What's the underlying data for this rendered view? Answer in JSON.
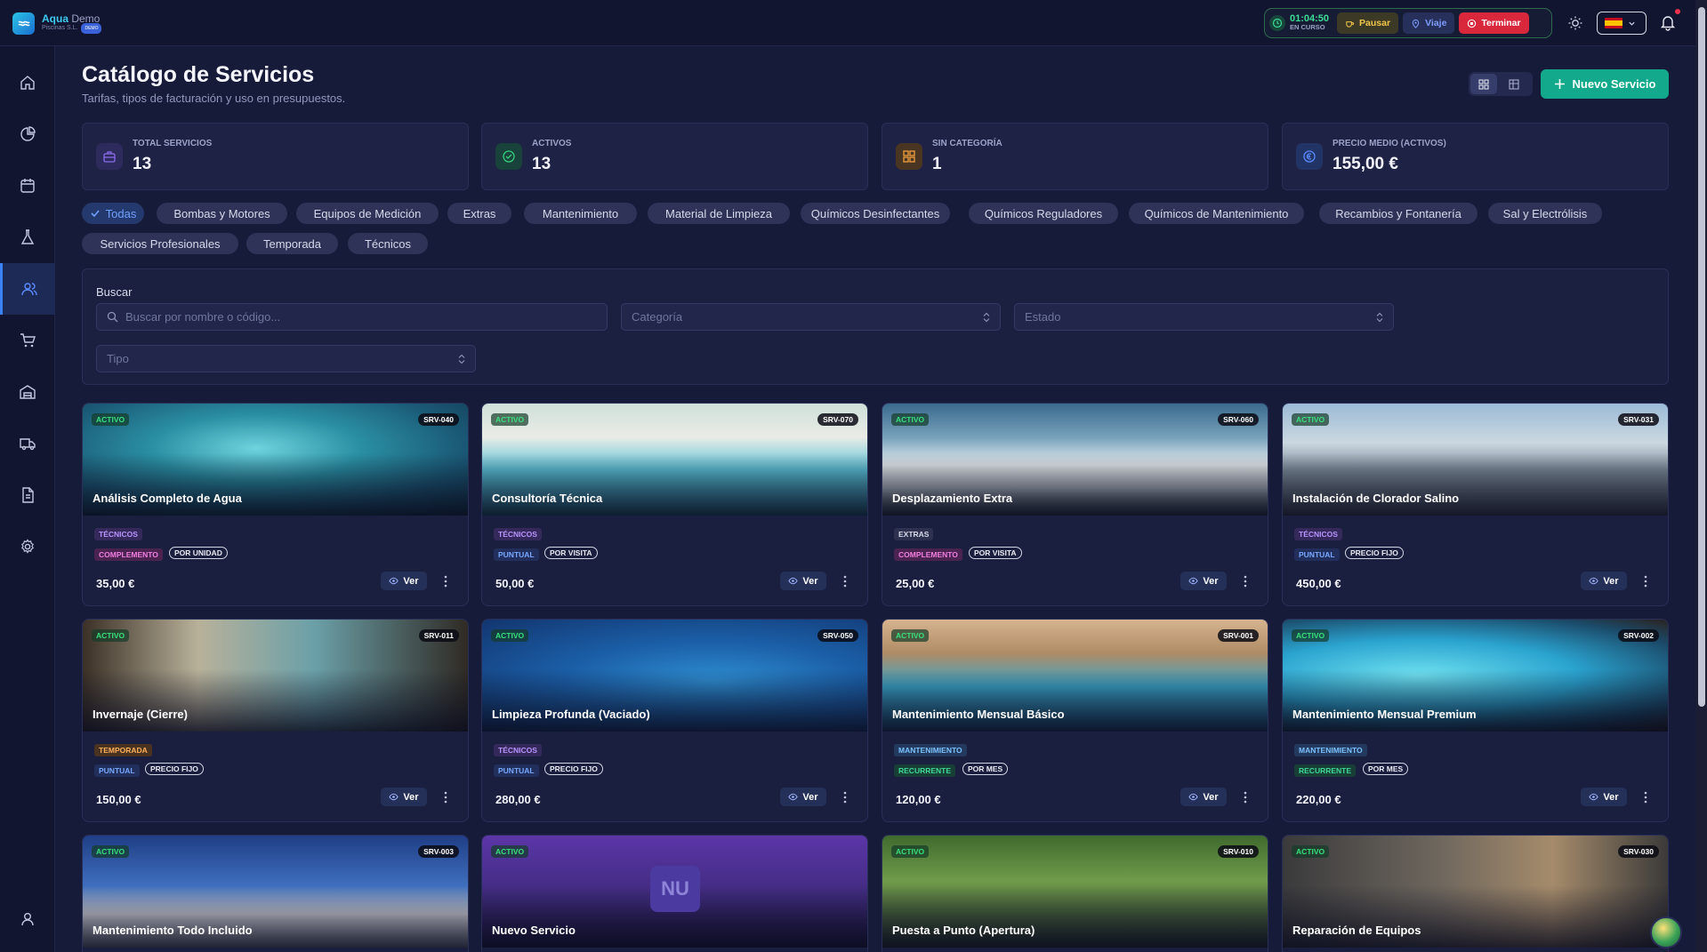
{
  "app": {
    "name": "Aqua",
    "name_suffix": "Demo",
    "company": "Piscinas S.L.",
    "badge": "DEMO"
  },
  "session": {
    "time": "01:04:50",
    "status": "EN CURSO",
    "pause_label": "Pausar",
    "trip_label": "Viaje",
    "end_label": "Terminar"
  },
  "page": {
    "title": "Catálogo de Servicios",
    "subtitle": "Tarifas, tipos de facturación y uso en presupuestos.",
    "new_button": "Nuevo Servicio"
  },
  "stats": [
    {
      "label": "Total Servicios",
      "value": "13",
      "icon": "briefcase-icon",
      "color": "#8b6cf0"
    },
    {
      "label": "Activos",
      "value": "13",
      "icon": "check-circle-icon",
      "color": "#35d07f"
    },
    {
      "label": "Sin Categoría",
      "value": "1",
      "icon": "grid-icon",
      "color": "#f0a040"
    },
    {
      "label": "Precio Medio (Activos)",
      "value": "155,00 €",
      "icon": "euro-icon",
      "color": "#5b8cff"
    }
  ],
  "categories": [
    "Todas",
    "Bombas y Motores",
    "Equipos de Medición",
    "Extras",
    "Mantenimiento",
    "Material de Limpieza",
    "Químicos Desinfectantes",
    "Químicos Reguladores",
    "Químicos de Mantenimiento",
    "Recambios y Fontanería",
    "Sal y Electrólisis",
    "Servicios Profesionales",
    "Temporada",
    "Técnicos"
  ],
  "filters": {
    "search_label": "Buscar",
    "search_placeholder": "Buscar por nombre o código...",
    "category_placeholder": "Categoría",
    "status_placeholder": "Estado",
    "type_placeholder": "Tipo"
  },
  "view_label": "Ver",
  "cards": [
    {
      "title": "Análisis Completo de Agua",
      "code": "SRV-040",
      "status": "ACTIVO",
      "category": "TÉCNICOS",
      "kind": "COMPLEMENTO",
      "billing": "POR UNIDAD",
      "price": "35,00 €"
    },
    {
      "title": "Consultoría Técnica",
      "code": "SRV-070",
      "status": "ACTIVO",
      "category": "TÉCNICOS",
      "kind": "PUNTUAL",
      "billing": "POR VISITA",
      "price": "50,00 €"
    },
    {
      "title": "Desplazamiento Extra",
      "code": "SRV-060",
      "status": "ACTIVO",
      "category": "EXTRAS",
      "kind": "COMPLEMENTO",
      "billing": "POR VISITA",
      "price": "25,00 €"
    },
    {
      "title": "Instalación de Clorador Salino",
      "code": "SRV-031",
      "status": "ACTIVO",
      "category": "TÉCNICOS",
      "kind": "PUNTUAL",
      "billing": "PRECIO FIJO",
      "price": "450,00 €"
    },
    {
      "title": "Invernaje (Cierre)",
      "code": "SRV-011",
      "status": "ACTIVO",
      "category": "TEMPORADA",
      "kind": "PUNTUAL",
      "billing": "PRECIO FIJO",
      "price": "150,00 €"
    },
    {
      "title": "Limpieza Profunda (Vaciado)",
      "code": "SRV-050",
      "status": "ACTIVO",
      "category": "TÉCNICOS",
      "kind": "PUNTUAL",
      "billing": "PRECIO FIJO",
      "price": "280,00 €"
    },
    {
      "title": "Mantenimiento Mensual Básico",
      "code": "SRV-001",
      "status": "ACTIVO",
      "category": "MANTENIMIENTO",
      "kind": "RECURRENTE",
      "billing": "POR MES",
      "price": "120,00 €"
    },
    {
      "title": "Mantenimiento Mensual Premium",
      "code": "SRV-002",
      "status": "ACTIVO",
      "category": "MANTENIMIENTO",
      "kind": "RECURRENTE",
      "billing": "POR MES",
      "price": "220,00 €"
    },
    {
      "title": "Mantenimiento Todo Incluido",
      "code": "SRV-003",
      "status": "ACTIVO"
    },
    {
      "title": "Nuevo Servicio",
      "code": "",
      "status": "ACTIVO",
      "initials": "NU"
    },
    {
      "title": "Puesta a Punto (Apertura)",
      "code": "SRV-010",
      "status": "ACTIVO"
    },
    {
      "title": "Reparación de Equipos",
      "code": "SRV-030",
      "status": "ACTIVO"
    }
  ]
}
